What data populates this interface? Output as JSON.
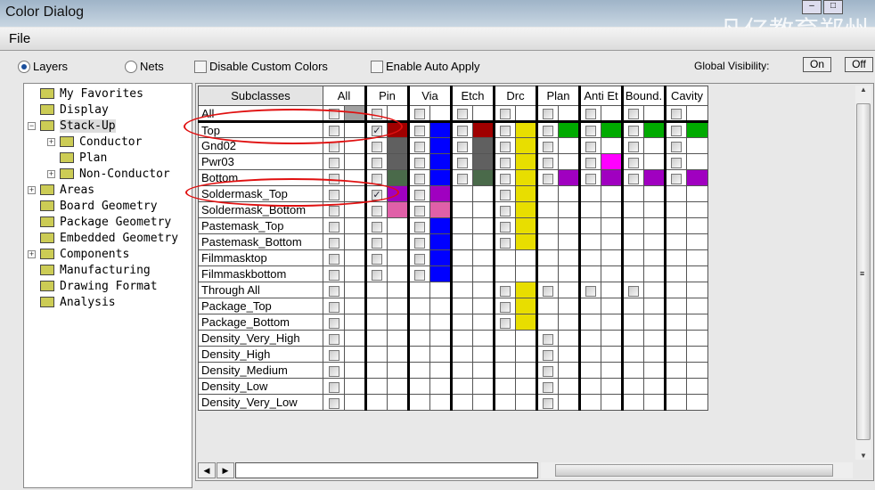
{
  "window": {
    "title": "Color Dialog",
    "watermark": "凡亿教育郑州"
  },
  "menu": {
    "file": "File"
  },
  "options": {
    "layers": "Layers",
    "nets": "Nets",
    "layers_selected": true,
    "disable_custom_colors": "Disable Custom Colors",
    "disable_custom_colors_checked": false,
    "enable_auto_apply": "Enable Auto Apply",
    "enable_auto_apply_checked": false,
    "global_visibility": "Global Visibility:",
    "on": "On",
    "off": "Off"
  },
  "tree": [
    {
      "label": "My Favorites",
      "level": 0,
      "expander": ""
    },
    {
      "label": "Display",
      "level": 0,
      "expander": ""
    },
    {
      "label": "Stack-Up",
      "level": 0,
      "expander": "-",
      "selected": true
    },
    {
      "label": "Conductor",
      "level": 1,
      "expander": "+"
    },
    {
      "label": "Plan",
      "level": 1,
      "expander": ""
    },
    {
      "label": "Non-Conductor",
      "level": 1,
      "expander": "+"
    },
    {
      "label": "Areas",
      "level": 0,
      "expander": "+"
    },
    {
      "label": "Board Geometry",
      "level": 0,
      "expander": ""
    },
    {
      "label": "Package Geometry",
      "level": 0,
      "expander": ""
    },
    {
      "label": "Embedded Geometry",
      "level": 0,
      "expander": ""
    },
    {
      "label": "Components",
      "level": 0,
      "expander": "+"
    },
    {
      "label": "Manufacturing",
      "level": 0,
      "expander": ""
    },
    {
      "label": "Drawing Format",
      "level": 0,
      "expander": ""
    },
    {
      "label": "Analysis",
      "level": 0,
      "expander": ""
    }
  ],
  "grid": {
    "subclasses_header": "Subclasses",
    "columns": [
      "All",
      "Pin",
      "Via",
      "Etch",
      "Drc",
      "Plan",
      "Anti Et",
      "Bound.",
      "Cavity"
    ],
    "rows": [
      {
        "name": "All",
        "cells": [
          [
            "c",
            "#a0a0a0"
          ],
          [
            "c",
            ""
          ],
          [
            "c",
            ""
          ],
          [
            "c",
            ""
          ],
          [
            "c",
            ""
          ],
          [
            "c",
            ""
          ],
          [
            "c",
            ""
          ],
          [
            "c",
            ""
          ],
          [
            "c",
            ""
          ]
        ]
      },
      {
        "name": "Top",
        "cells": [
          [
            "c",
            ""
          ],
          [
            "x",
            "#a00000"
          ],
          [
            "c",
            "#0000ff"
          ],
          [
            "c",
            "#a00000"
          ],
          [
            "c",
            "#e8de00"
          ],
          [
            "c",
            "#00aa00"
          ],
          [
            "c",
            "#00aa00"
          ],
          [
            "c",
            "#00aa00"
          ],
          [
            "c",
            "#00aa00"
          ]
        ]
      },
      {
        "name": "Gnd02",
        "cells": [
          [
            "c",
            ""
          ],
          [
            "c",
            "#606060"
          ],
          [
            "c",
            "#0000ff"
          ],
          [
            "c",
            "#606060"
          ],
          [
            "c",
            "#e8de00"
          ],
          [
            "c",
            ""
          ],
          [
            "c",
            ""
          ],
          [
            "c",
            ""
          ],
          [
            "c",
            ""
          ]
        ]
      },
      {
        "name": "Pwr03",
        "cells": [
          [
            "c",
            ""
          ],
          [
            "c",
            "#606060"
          ],
          [
            "c",
            "#0000ff"
          ],
          [
            "c",
            "#606060"
          ],
          [
            "c",
            "#e8de00"
          ],
          [
            "c",
            ""
          ],
          [
            "c",
            "#ff00ff"
          ],
          [
            "c",
            ""
          ],
          [
            "c",
            ""
          ]
        ]
      },
      {
        "name": "Bottom",
        "cells": [
          [
            "c",
            ""
          ],
          [
            "c",
            "#4a6a4a"
          ],
          [
            "c",
            "#0000ff"
          ],
          [
            "c",
            "#4a6a4a"
          ],
          [
            "c",
            "#e8de00"
          ],
          [
            "c",
            "#a000c0"
          ],
          [
            "c",
            "#a000c0"
          ],
          [
            "c",
            "#a000c0"
          ],
          [
            "c",
            "#a000c0"
          ]
        ]
      },
      {
        "name": "Soldermask_Top",
        "cells": [
          [
            "c",
            ""
          ],
          [
            "x",
            "#a000c0"
          ],
          [
            "c",
            "#a000c0"
          ],
          [
            "",
            ""
          ],
          [
            "c",
            "#e8de00"
          ],
          [
            "",
            ""
          ],
          [
            "",
            ""
          ],
          [
            "",
            ""
          ],
          [
            "",
            ""
          ]
        ]
      },
      {
        "name": "Soldermask_Bottom",
        "cells": [
          [
            "c",
            ""
          ],
          [
            "c",
            "#e060a8"
          ],
          [
            "c",
            "#e060a8"
          ],
          [
            "",
            ""
          ],
          [
            "c",
            "#e8de00"
          ],
          [
            "",
            ""
          ],
          [
            "",
            ""
          ],
          [
            "",
            ""
          ],
          [
            "",
            ""
          ]
        ]
      },
      {
        "name": "Pastemask_Top",
        "cells": [
          [
            "c",
            ""
          ],
          [
            "c",
            ""
          ],
          [
            "c",
            "#0000ff"
          ],
          [
            "",
            ""
          ],
          [
            "c",
            "#e8de00"
          ],
          [
            "",
            ""
          ],
          [
            "",
            ""
          ],
          [
            "",
            ""
          ],
          [
            "",
            ""
          ]
        ]
      },
      {
        "name": "Pastemask_Bottom",
        "cells": [
          [
            "c",
            ""
          ],
          [
            "c",
            ""
          ],
          [
            "c",
            "#0000ff"
          ],
          [
            "",
            ""
          ],
          [
            "c",
            "#e8de00"
          ],
          [
            "",
            ""
          ],
          [
            "",
            ""
          ],
          [
            "",
            ""
          ],
          [
            "",
            ""
          ]
        ]
      },
      {
        "name": "Filmmasktop",
        "cells": [
          [
            "c",
            ""
          ],
          [
            "c",
            ""
          ],
          [
            "c",
            "#0000ff"
          ],
          [
            "",
            ""
          ],
          [
            "",
            ""
          ],
          [
            "",
            ""
          ],
          [
            "",
            ""
          ],
          [
            "",
            ""
          ],
          [
            "",
            ""
          ]
        ]
      },
      {
        "name": "Filmmaskbottom",
        "cells": [
          [
            "c",
            ""
          ],
          [
            "c",
            ""
          ],
          [
            "c",
            "#0000ff"
          ],
          [
            "",
            ""
          ],
          [
            "",
            ""
          ],
          [
            "",
            ""
          ],
          [
            "",
            ""
          ],
          [
            "",
            ""
          ],
          [
            "",
            ""
          ]
        ]
      },
      {
        "name": "Through All",
        "cells": [
          [
            "c",
            ""
          ],
          [
            "",
            ""
          ],
          [
            "",
            ""
          ],
          [
            "",
            ""
          ],
          [
            "c",
            "#e8de00"
          ],
          [
            "c",
            ""
          ],
          [
            "c",
            ""
          ],
          [
            "c",
            ""
          ],
          [
            "",
            ""
          ]
        ]
      },
      {
        "name": "Package_Top",
        "cells": [
          [
            "c",
            ""
          ],
          [
            "",
            ""
          ],
          [
            "",
            ""
          ],
          [
            "",
            ""
          ],
          [
            "c",
            "#e8de00"
          ],
          [
            "",
            ""
          ],
          [
            "",
            ""
          ],
          [
            "",
            ""
          ],
          [
            "",
            ""
          ]
        ]
      },
      {
        "name": "Package_Bottom",
        "cells": [
          [
            "c",
            ""
          ],
          [
            "",
            ""
          ],
          [
            "",
            ""
          ],
          [
            "",
            ""
          ],
          [
            "c",
            "#e8de00"
          ],
          [
            "",
            ""
          ],
          [
            "",
            ""
          ],
          [
            "",
            ""
          ],
          [
            "",
            ""
          ]
        ]
      },
      {
        "name": "Density_Very_High",
        "cells": [
          [
            "c",
            ""
          ],
          [
            "",
            ""
          ],
          [
            "",
            ""
          ],
          [
            "",
            ""
          ],
          [
            "",
            ""
          ],
          [
            "c",
            ""
          ],
          [
            "",
            ""
          ],
          [
            "",
            ""
          ],
          [
            "",
            ""
          ]
        ]
      },
      {
        "name": "Density_High",
        "cells": [
          [
            "c",
            ""
          ],
          [
            "",
            ""
          ],
          [
            "",
            ""
          ],
          [
            "",
            ""
          ],
          [
            "",
            ""
          ],
          [
            "c",
            ""
          ],
          [
            "",
            ""
          ],
          [
            "",
            ""
          ],
          [
            "",
            ""
          ]
        ]
      },
      {
        "name": "Density_Medium",
        "cells": [
          [
            "c",
            ""
          ],
          [
            "",
            ""
          ],
          [
            "",
            ""
          ],
          [
            "",
            ""
          ],
          [
            "",
            ""
          ],
          [
            "c",
            ""
          ],
          [
            "",
            ""
          ],
          [
            "",
            ""
          ],
          [
            "",
            ""
          ]
        ]
      },
      {
        "name": "Density_Low",
        "cells": [
          [
            "c",
            ""
          ],
          [
            "",
            ""
          ],
          [
            "",
            ""
          ],
          [
            "",
            ""
          ],
          [
            "",
            ""
          ],
          [
            "c",
            ""
          ],
          [
            "",
            ""
          ],
          [
            "",
            ""
          ],
          [
            "",
            ""
          ]
        ]
      },
      {
        "name": "Density_Very_Low",
        "cells": [
          [
            "c",
            ""
          ],
          [
            "",
            ""
          ],
          [
            "",
            ""
          ],
          [
            "",
            ""
          ],
          [
            "",
            ""
          ],
          [
            "c",
            ""
          ],
          [
            "",
            ""
          ],
          [
            "",
            ""
          ],
          [
            "",
            ""
          ]
        ]
      }
    ]
  },
  "annotation_color": "#e01010"
}
